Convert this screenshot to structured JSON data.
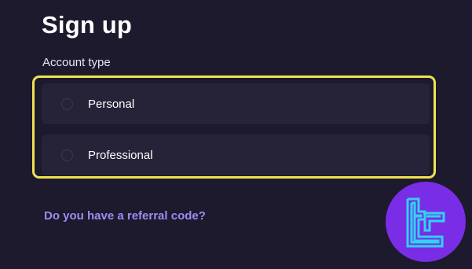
{
  "header": {
    "title": "Sign up"
  },
  "account_type": {
    "label": "Account type",
    "options": [
      {
        "label": "Personal",
        "selected": false
      },
      {
        "label": "Professional",
        "selected": false
      }
    ],
    "highlight_color": "#efe352"
  },
  "referral": {
    "link_text": "Do you have a referral code?"
  },
  "logo": {
    "icon": "brand-logo-icon",
    "background_color": "#7a2de6",
    "stroke_color": "#2fd3f2"
  },
  "colors": {
    "background": "#1c1a2c",
    "option_background": "#262339",
    "link": "#a089f2"
  }
}
